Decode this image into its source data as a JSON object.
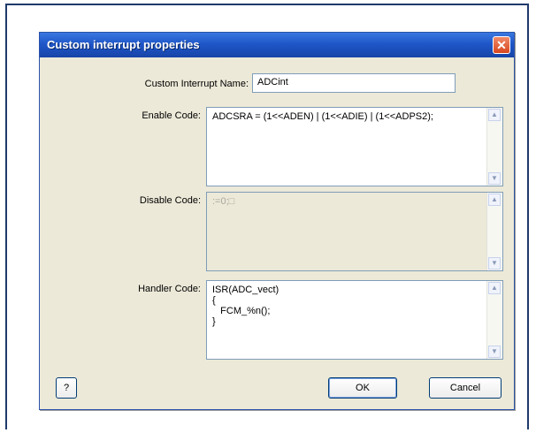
{
  "dialog": {
    "title": "Custom interrupt properties",
    "close_icon": "✕"
  },
  "fields": {
    "name_label": "Custom Interrupt Name:",
    "name_value": "ADCint",
    "enable_label": "Enable Code:",
    "enable_value": "ADCSRA = (1<<ADEN) | (1<<ADIE) | (1<<ADPS2);",
    "disable_label": "Disable Code:",
    "disable_value": ":=0;□",
    "handler_label": "Handler Code:",
    "handler_value": "ISR(ADC_vect)\n{\n   FCM_%n();\n}"
  },
  "buttons": {
    "help": "?",
    "ok": "OK",
    "cancel": "Cancel"
  },
  "icons": {
    "scroll_up": "▲",
    "scroll_down": "▼"
  },
  "colors": {
    "titlebar": "#1f56c8",
    "dialog_bg": "#ece9d8",
    "close": "#d8461f"
  }
}
